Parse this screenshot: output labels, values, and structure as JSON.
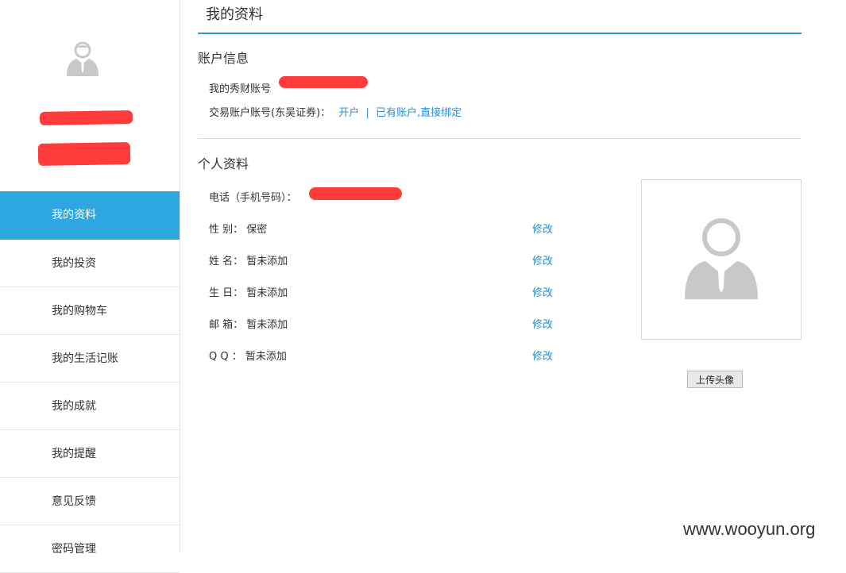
{
  "sidebar": {
    "nav_items": [
      {
        "label": "我的资料",
        "active": true
      },
      {
        "label": "我的投资",
        "active": false
      },
      {
        "label": "我的购物车",
        "active": false
      },
      {
        "label": "我的生活记账",
        "active": false
      },
      {
        "label": "我的成就",
        "active": false
      },
      {
        "label": "我的提醒",
        "active": false
      },
      {
        "label": "意见反馈",
        "active": false
      },
      {
        "label": "密码管理",
        "active": false
      }
    ],
    "active_color": "#2ea6e0"
  },
  "main": {
    "page_title": "我的资料",
    "account_section": {
      "title": "账户信息",
      "xiucai_account_label": "我的秀财账号",
      "trade_account_label": "交易账户账号(东吴证券)：",
      "open_account_link": "开户",
      "separator": "|",
      "bind_link": "已有账户,直接绑定"
    },
    "profile_section": {
      "title": "个人资料",
      "phone_label": "电话（手机号码）：",
      "fields": [
        {
          "label": "性 别：",
          "value": "保密",
          "edit": "修改"
        },
        {
          "label": "姓 名：",
          "value": "暂未添加",
          "edit": "修改"
        },
        {
          "label": "生 日：",
          "value": "暂未添加",
          "edit": "修改"
        },
        {
          "label": "邮 箱：",
          "value": "暂未添加",
          "edit": "修改"
        },
        {
          "label": "Q Q ：",
          "value": "暂未添加",
          "edit": "修改"
        }
      ],
      "upload_button": "上传头像"
    }
  },
  "watermark": "www.wooyun.org",
  "colors": {
    "accent": "#2b9bd0",
    "link": "#2b8fd0",
    "redaction": "#ff3b3b",
    "avatar_gray": "#c8c8c8"
  }
}
